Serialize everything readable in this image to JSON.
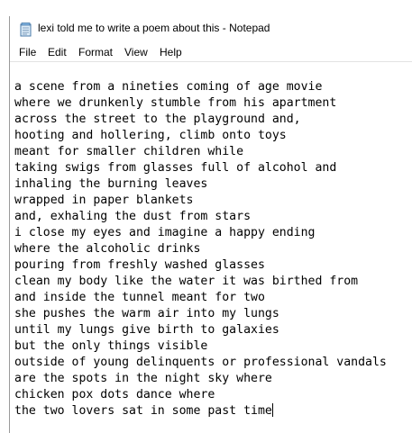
{
  "window": {
    "title": "lexi told me to write a poem about this - Notepad",
    "icon": "notepad-icon"
  },
  "menu": [
    "File",
    "Edit",
    "Format",
    "View",
    "Help"
  ],
  "editor": {
    "lines": [
      "a scene from a nineties coming of age movie",
      "where we drunkenly stumble from his apartment",
      "across the street to the playground and,",
      "hooting and hollering, climb onto toys",
      "meant for smaller children while",
      "taking swigs from glasses full of alcohol and",
      "inhaling the burning leaves",
      "wrapped in paper blankets",
      "and, exhaling the dust from stars",
      "i close my eyes and imagine a happy ending",
      "where the alcoholic drinks",
      "pouring from freshly washed glasses",
      "clean my body like the water it was birthed from",
      "and inside the tunnel meant for two",
      "she pushes the warm air into my lungs",
      "until my lungs give birth to galaxies",
      "but the only things visible",
      "outside of young delinquents or professional vandals",
      "are the spots in the night sky where",
      "chicken pox dots dance where",
      "the two lovers sat in some past time"
    ]
  }
}
